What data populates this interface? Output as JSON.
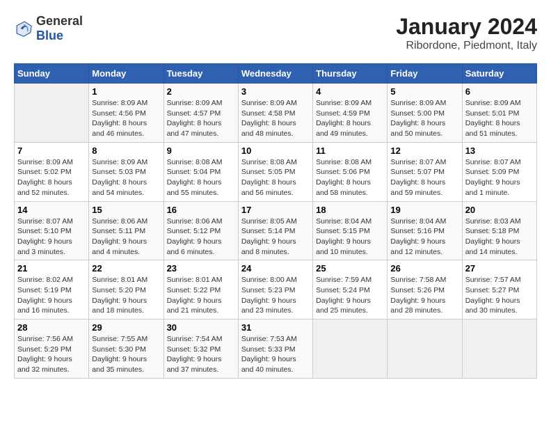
{
  "header": {
    "logo_general": "General",
    "logo_blue": "Blue",
    "title": "January 2024",
    "subtitle": "Ribordone, Piedmont, Italy"
  },
  "columns": [
    "Sunday",
    "Monday",
    "Tuesday",
    "Wednesday",
    "Thursday",
    "Friday",
    "Saturday"
  ],
  "weeks": [
    [
      {
        "day": "",
        "info": ""
      },
      {
        "day": "1",
        "info": "Sunrise: 8:09 AM\nSunset: 4:56 PM\nDaylight: 8 hours\nand 46 minutes."
      },
      {
        "day": "2",
        "info": "Sunrise: 8:09 AM\nSunset: 4:57 PM\nDaylight: 8 hours\nand 47 minutes."
      },
      {
        "day": "3",
        "info": "Sunrise: 8:09 AM\nSunset: 4:58 PM\nDaylight: 8 hours\nand 48 minutes."
      },
      {
        "day": "4",
        "info": "Sunrise: 8:09 AM\nSunset: 4:59 PM\nDaylight: 8 hours\nand 49 minutes."
      },
      {
        "day": "5",
        "info": "Sunrise: 8:09 AM\nSunset: 5:00 PM\nDaylight: 8 hours\nand 50 minutes."
      },
      {
        "day": "6",
        "info": "Sunrise: 8:09 AM\nSunset: 5:01 PM\nDaylight: 8 hours\nand 51 minutes."
      }
    ],
    [
      {
        "day": "7",
        "info": "Sunrise: 8:09 AM\nSunset: 5:02 PM\nDaylight: 8 hours\nand 52 minutes."
      },
      {
        "day": "8",
        "info": "Sunrise: 8:09 AM\nSunset: 5:03 PM\nDaylight: 8 hours\nand 54 minutes."
      },
      {
        "day": "9",
        "info": "Sunrise: 8:08 AM\nSunset: 5:04 PM\nDaylight: 8 hours\nand 55 minutes."
      },
      {
        "day": "10",
        "info": "Sunrise: 8:08 AM\nSunset: 5:05 PM\nDaylight: 8 hours\nand 56 minutes."
      },
      {
        "day": "11",
        "info": "Sunrise: 8:08 AM\nSunset: 5:06 PM\nDaylight: 8 hours\nand 58 minutes."
      },
      {
        "day": "12",
        "info": "Sunrise: 8:07 AM\nSunset: 5:07 PM\nDaylight: 8 hours\nand 59 minutes."
      },
      {
        "day": "13",
        "info": "Sunrise: 8:07 AM\nSunset: 5:09 PM\nDaylight: 9 hours\nand 1 minute."
      }
    ],
    [
      {
        "day": "14",
        "info": "Sunrise: 8:07 AM\nSunset: 5:10 PM\nDaylight: 9 hours\nand 3 minutes."
      },
      {
        "day": "15",
        "info": "Sunrise: 8:06 AM\nSunset: 5:11 PM\nDaylight: 9 hours\nand 4 minutes."
      },
      {
        "day": "16",
        "info": "Sunrise: 8:06 AM\nSunset: 5:12 PM\nDaylight: 9 hours\nand 6 minutes."
      },
      {
        "day": "17",
        "info": "Sunrise: 8:05 AM\nSunset: 5:14 PM\nDaylight: 9 hours\nand 8 minutes."
      },
      {
        "day": "18",
        "info": "Sunrise: 8:04 AM\nSunset: 5:15 PM\nDaylight: 9 hours\nand 10 minutes."
      },
      {
        "day": "19",
        "info": "Sunrise: 8:04 AM\nSunset: 5:16 PM\nDaylight: 9 hours\nand 12 minutes."
      },
      {
        "day": "20",
        "info": "Sunrise: 8:03 AM\nSunset: 5:18 PM\nDaylight: 9 hours\nand 14 minutes."
      }
    ],
    [
      {
        "day": "21",
        "info": "Sunrise: 8:02 AM\nSunset: 5:19 PM\nDaylight: 9 hours\nand 16 minutes."
      },
      {
        "day": "22",
        "info": "Sunrise: 8:01 AM\nSunset: 5:20 PM\nDaylight: 9 hours\nand 18 minutes."
      },
      {
        "day": "23",
        "info": "Sunrise: 8:01 AM\nSunset: 5:22 PM\nDaylight: 9 hours\nand 21 minutes."
      },
      {
        "day": "24",
        "info": "Sunrise: 8:00 AM\nSunset: 5:23 PM\nDaylight: 9 hours\nand 23 minutes."
      },
      {
        "day": "25",
        "info": "Sunrise: 7:59 AM\nSunset: 5:24 PM\nDaylight: 9 hours\nand 25 minutes."
      },
      {
        "day": "26",
        "info": "Sunrise: 7:58 AM\nSunset: 5:26 PM\nDaylight: 9 hours\nand 28 minutes."
      },
      {
        "day": "27",
        "info": "Sunrise: 7:57 AM\nSunset: 5:27 PM\nDaylight: 9 hours\nand 30 minutes."
      }
    ],
    [
      {
        "day": "28",
        "info": "Sunrise: 7:56 AM\nSunset: 5:29 PM\nDaylight: 9 hours\nand 32 minutes."
      },
      {
        "day": "29",
        "info": "Sunrise: 7:55 AM\nSunset: 5:30 PM\nDaylight: 9 hours\nand 35 minutes."
      },
      {
        "day": "30",
        "info": "Sunrise: 7:54 AM\nSunset: 5:32 PM\nDaylight: 9 hours\nand 37 minutes."
      },
      {
        "day": "31",
        "info": "Sunrise: 7:53 AM\nSunset: 5:33 PM\nDaylight: 9 hours\nand 40 minutes."
      },
      {
        "day": "",
        "info": ""
      },
      {
        "day": "",
        "info": ""
      },
      {
        "day": "",
        "info": ""
      }
    ]
  ]
}
